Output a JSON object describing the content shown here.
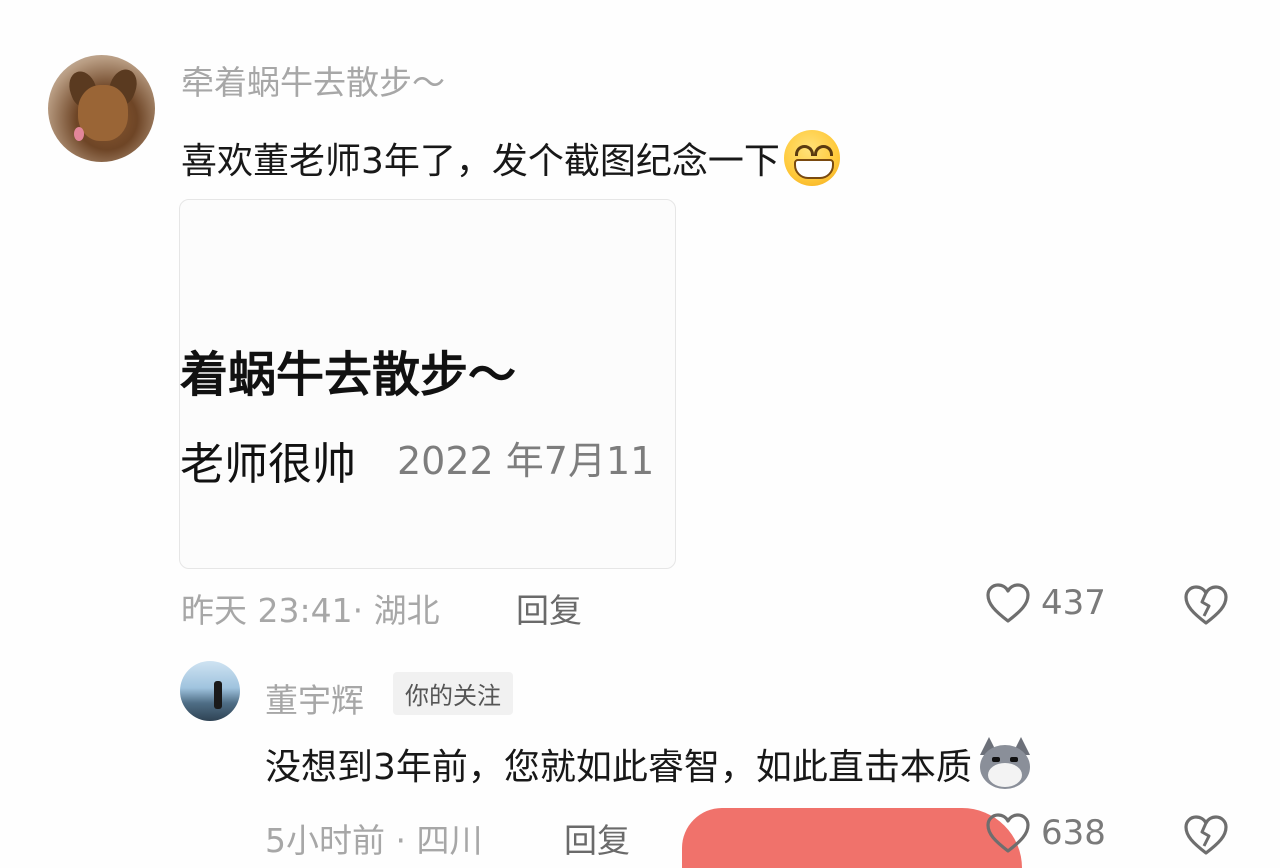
{
  "comment": {
    "username": "牵着蜗牛去散步～",
    "text": "喜欢董老师3年了，发个截图纪念一下",
    "emoji": "grin-emoji",
    "image": {
      "title": "着蜗牛去散步～",
      "body": "老师很帅",
      "date": "2022 年7月11"
    },
    "meta": "昨天 23:41· 湖北",
    "reply_label": "回复",
    "likes": "437"
  },
  "reply": {
    "username": "董宇辉",
    "badge": "你的关注",
    "text": "没想到3年前，您就如此睿智，如此直击本质",
    "emoji": "husky-emoji",
    "meta": "5小时前 · 四川",
    "reply_label": "回复",
    "likes": "638"
  }
}
